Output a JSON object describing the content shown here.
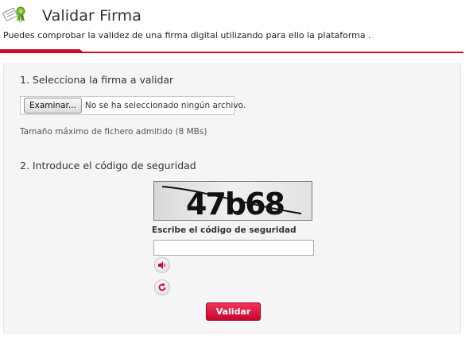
{
  "header": {
    "title": "Validar Firma",
    "icon": "signature-ribbon-icon",
    "accent_color": "#c8102e"
  },
  "intro": {
    "text": "Puedes comprobar la validez de una firma digital utilizando para ello la plataforma ."
  },
  "step1": {
    "title": "1. Selecciona la firma a validar",
    "file_button_label": "Examinar...",
    "file_status": "No se ha seleccionado ningún archivo.",
    "max_size_note": "Tamaño máximo de fichero admitido (8 MBs)"
  },
  "step2": {
    "title": "2. Introduce el código de seguridad",
    "captcha_text": "47b68",
    "captcha_label": "Escribe el código de seguridad",
    "captcha_input_value": "",
    "audio_icon": "speaker-icon",
    "refresh_icon": "refresh-icon"
  },
  "submit": {
    "label": "Validar",
    "color": "#e0183f"
  }
}
